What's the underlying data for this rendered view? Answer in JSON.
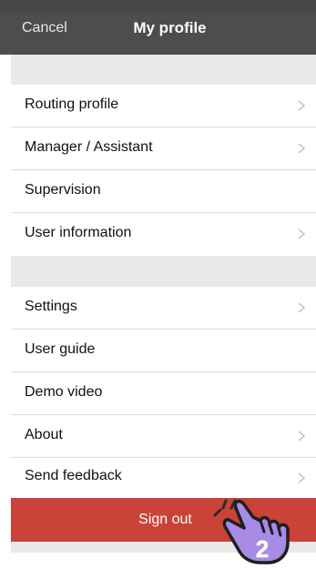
{
  "navbar": {
    "cancel_label": "Cancel",
    "title": "My profile"
  },
  "groups": [
    {
      "items": [
        {
          "label": "Routing profile",
          "chevron": true
        },
        {
          "label": "Manager / Assistant",
          "chevron": true
        },
        {
          "label": "Supervision",
          "chevron": false
        },
        {
          "label": "User information",
          "chevron": true
        }
      ]
    },
    {
      "items": [
        {
          "label": "Settings",
          "chevron": true
        },
        {
          "label": "User guide",
          "chevron": false
        },
        {
          "label": "Demo video",
          "chevron": false
        },
        {
          "label": "About",
          "chevron": true
        },
        {
          "label": "Send feedback",
          "chevron": true
        }
      ]
    }
  ],
  "signout_label": "Sign out",
  "pointer": {
    "icon": "hand-pointer-icon",
    "step_number": "2",
    "color": "#a78be4"
  },
  "colors": {
    "navbar": "#4d4d4d",
    "signout": "#cb4338",
    "section_bg": "#e9e9e9"
  }
}
